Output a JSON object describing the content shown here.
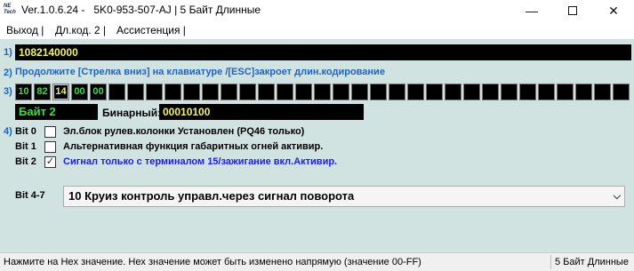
{
  "titlebar": {
    "logo_line1": "NE",
    "logo_line2": "Tech",
    "title": "Ver.1.0.6.24 -   5K0-953-507-AJ | 5 Байт Длинные",
    "minimize": "—",
    "close": "✕"
  },
  "menu": {
    "items": [
      {
        "label": "Выход |"
      },
      {
        "label": "Дл.код. 2 |"
      },
      {
        "label": "Ассистенция |"
      }
    ]
  },
  "row_numbers": {
    "r1": "1)",
    "r2": "2)",
    "r3": "3)",
    "r4": "4)"
  },
  "ident": {
    "value": "1082140000"
  },
  "hint": "Продолжите [Стрелка вниз] на клавиатуре /[ESC]закроет длин.кодирование",
  "hex_cells": [
    {
      "value": "10",
      "active": false
    },
    {
      "value": "82",
      "active": false
    },
    {
      "value": "14",
      "active": true
    },
    {
      "value": "00",
      "active": false
    },
    {
      "value": "00",
      "active": false
    },
    {
      "value": "",
      "active": false
    },
    {
      "value": "",
      "active": false
    },
    {
      "value": "",
      "active": false
    },
    {
      "value": "",
      "active": false
    },
    {
      "value": "",
      "active": false
    },
    {
      "value": "",
      "active": false
    },
    {
      "value": "",
      "active": false
    },
    {
      "value": "",
      "active": false
    },
    {
      "value": "",
      "active": false
    },
    {
      "value": "",
      "active": false
    },
    {
      "value": "",
      "active": false
    },
    {
      "value": "",
      "active": false
    },
    {
      "value": "",
      "active": false
    },
    {
      "value": "",
      "active": false
    },
    {
      "value": "",
      "active": false
    },
    {
      "value": "",
      "active": false
    },
    {
      "value": "",
      "active": false
    },
    {
      "value": "",
      "active": false
    },
    {
      "value": "",
      "active": false
    },
    {
      "value": "",
      "active": false
    },
    {
      "value": "",
      "active": false
    },
    {
      "value": "",
      "active": false
    },
    {
      "value": "",
      "active": false
    },
    {
      "value": "",
      "active": false
    },
    {
      "value": "",
      "active": false
    },
    {
      "value": "",
      "active": false
    },
    {
      "value": "",
      "active": false
    },
    {
      "value": "",
      "active": false
    }
  ],
  "byte_panel": {
    "byte_label": "Байт 2",
    "binary_label": "Бинарный:",
    "binary_value": "00010100"
  },
  "bits": [
    {
      "name": "Bit 0",
      "checked": false,
      "desc": "Эл.блок рулев.колонки Установлен (PQ46 только)"
    },
    {
      "name": "Bit 1",
      "checked": false,
      "desc": "Альтернативная функция габаритных огней активир."
    },
    {
      "name": "Bit 2",
      "checked": true,
      "desc": "Сигнал только с терминалом 15/зажигание вкл.Активир."
    }
  ],
  "bit47": {
    "label": "Bit 4-7",
    "selected": "10 Круиз контроль управл.через сигнал поворота"
  },
  "status": {
    "left": "Нажмите на Hex значение. Hex значение может быть изменено напрямую (значение 00-FF)",
    "right": "5 Байт Длинные"
  },
  "colors": {
    "background": "#d1e3e0",
    "accent_blue": "#1c63c6",
    "value_yellow": "#f4f25f",
    "value_green": "#36e236",
    "active_desc": "#1a1aff"
  },
  "icons": {
    "minimize": "minimize-icon",
    "maximize": "maximize-icon",
    "close": "close-icon",
    "dropdown": "chevron-down-icon",
    "checkmark": "checkmark-icon"
  }
}
